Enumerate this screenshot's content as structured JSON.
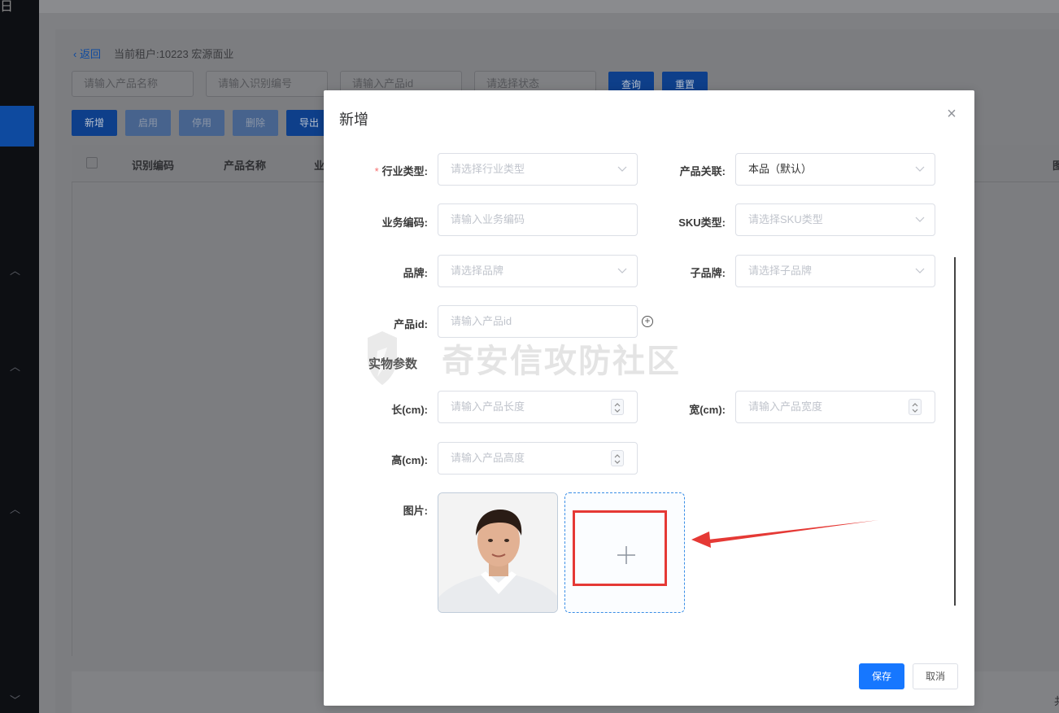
{
  "sidebar": {
    "top_glyph": "日"
  },
  "page": {
    "back_label": "返回",
    "tenant_text": "当前租户:10223 宏源面业",
    "filters": {
      "product_name_placeholder": "请输入产品名称",
      "code_placeholder": "请输入识别编号",
      "product_id_placeholder": "请输入产品id",
      "status_placeholder": "请选择状态"
    },
    "query_label": "查询",
    "reset_label": "重置",
    "toolbar": {
      "add": "新增",
      "enable": "启用",
      "disable": "停用",
      "delete": "删除",
      "export": "导出"
    },
    "table_headers": [
      "识别编码",
      "产品名称",
      "业",
      "图"
    ],
    "footer_partial": "共"
  },
  "modal": {
    "title": "新增",
    "close_icon": "close-icon",
    "fields": {
      "industry": {
        "label": "行业类型:",
        "placeholder": "请选择行业类型",
        "required": true
      },
      "product_link": {
        "label": "产品关联:",
        "value": "本品（默认）"
      },
      "business_code": {
        "label": "业务编码:",
        "placeholder": "请输入业务编码"
      },
      "sku_type": {
        "label": "SKU类型:",
        "placeholder": "请选择SKU类型"
      },
      "brand": {
        "label": "品牌:",
        "placeholder": "请选择品牌"
      },
      "sub_brand": {
        "label": "子品牌:",
        "placeholder": "请选择子品牌"
      },
      "product_id": {
        "label": "产品id:",
        "placeholder": "请输入产品id"
      }
    },
    "physical_section": "实物参数",
    "dimensions": {
      "length": {
        "label": "长(cm):",
        "placeholder": "请输入产品长度"
      },
      "width": {
        "label": "宽(cm):",
        "placeholder": "请输入产品宽度"
      },
      "height": {
        "label": "高(cm):",
        "placeholder": "请输入产品高度"
      }
    },
    "image_label": "图片:",
    "watermark": "奇安信攻防社区",
    "save_label": "保存",
    "cancel_label": "取消"
  },
  "colors": {
    "primary": "#1677ff",
    "highlight": "#e53935",
    "required": "#f56c6c"
  }
}
